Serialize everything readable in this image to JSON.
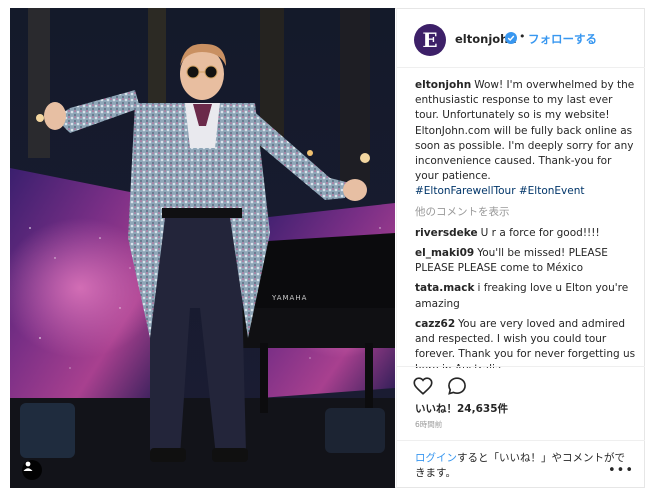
{
  "post": {
    "username": "eltonjohn",
    "avatar_letter": "E",
    "verified": true,
    "separator": "•",
    "follow_label": "フォローする",
    "caption_user": "eltonjohn",
    "caption_text": "Wow! I'm overwhelmed by the enthusiastic response to my last ever tour. Unfortunately so is my website! EltonJohn.com will be fully back online as soon as possible. I'm deeply sorry for any inconvenience caused. Thank-you for your patience.",
    "hashtags": "#EltonFarewellTour #EltonEvent",
    "load_more_label": "他のコメントを表示",
    "comments": [
      {
        "user": "riversdeke",
        "text": "U r a force for good!!!!"
      },
      {
        "user": "el_maki09",
        "text": "You'll be missed! PLEASE PLEASE PLEASE come to México"
      },
      {
        "user": "tata.mack",
        "text": "i freaking love u Elton you're amazing"
      },
      {
        "user": "cazz62",
        "text": "You are very loved and admired and respected. I wish you could tour forever. Thank you for never forgetting us here in Australia"
      }
    ],
    "likes_text": "いいね！24,635件",
    "time_ago": "6時間前",
    "login_link": "ログイン",
    "login_text": "すると「いいね！」やコメントができます。",
    "more_label": "•••",
    "photo_text": "YAMAHA"
  },
  "colors": {
    "accent": "#3897f0",
    "hashtag": "#003569",
    "muted": "#999999",
    "avatar_bg": "#3d2068"
  },
  "icons": [
    "user-tag-icon",
    "verified-badge-icon",
    "heart-icon",
    "comment-icon",
    "more-options-icon"
  ]
}
